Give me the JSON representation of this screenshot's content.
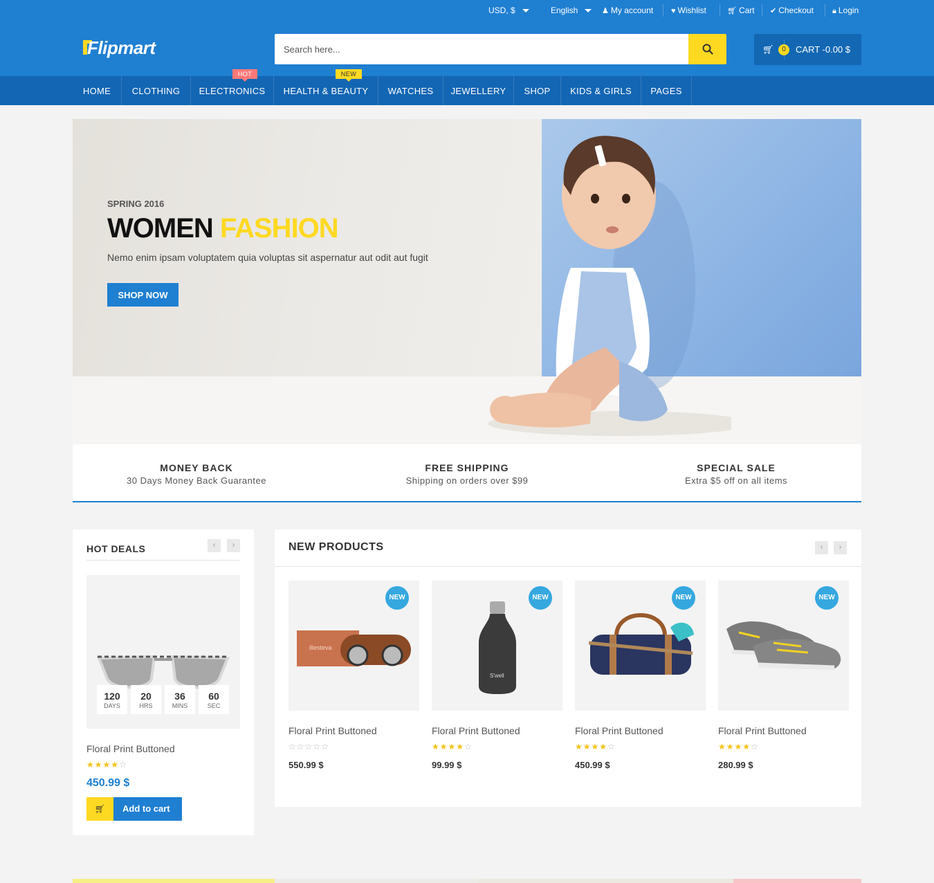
{
  "topbar": {
    "currency": "USD, $",
    "language": "English",
    "links": {
      "my_account": "My account",
      "wishlist": "Wishlist",
      "cart": "Cart",
      "checkout": "Checkout",
      "login": "Login"
    }
  },
  "header": {
    "logo_text": "Flipmart",
    "search_placeholder": "Search here...",
    "cart_count": "0",
    "cart_label": "CART -0.00 $"
  },
  "nav": {
    "items": [
      "HOME",
      "CLOTHING",
      "ELECTRONICS",
      "HEALTH & BEAUTY",
      "WATCHES",
      "JEWELLERY",
      "SHOP",
      "KIDS & GIRLS",
      "PAGES"
    ],
    "badges": {
      "hot": "HOT",
      "new": "NEW"
    }
  },
  "hero": {
    "season": "SPRING 2016",
    "headline_dark": "WOMEN",
    "headline_accent": "FASHION",
    "subtext": "Nemo enim ipsam voluptatem quia voluptas sit aspernatur aut odit aut fugit",
    "cta": "SHOP NOW"
  },
  "info_boxes": [
    {
      "title": "MONEY BACK",
      "subtitle": "30 Days Money Back Guarantee"
    },
    {
      "title": "FREE SHIPPING",
      "subtitle": "Shipping on orders over $99"
    },
    {
      "title": "SPECIAL SALE",
      "subtitle": "Extra $5 off on all items"
    }
  ],
  "hot_deals": {
    "title": "HOT DEALS",
    "countdown": [
      {
        "value": "120",
        "label": "DAYS"
      },
      {
        "value": "20",
        "label": "HRS"
      },
      {
        "value": "36",
        "label": "MINS"
      },
      {
        "value": "60",
        "label": "SEC"
      }
    ],
    "product": {
      "name": "Floral Print Buttoned",
      "rating": 4,
      "price": "450.99 $"
    },
    "add_to_cart": "Add to cart"
  },
  "new_products": {
    "title": "NEW PRODUCTS",
    "badge": "NEW",
    "items": [
      {
        "name": "Floral Print Buttoned",
        "rating": 0,
        "price": "550.99 $",
        "image": "sunglasses-with-case"
      },
      {
        "name": "Floral Print Buttoned",
        "rating": 4,
        "price": "99.99 $",
        "image": "black-water-bottle"
      },
      {
        "name": "Floral Print Buttoned",
        "rating": 4,
        "price": "450.99 $",
        "image": "navy-duffel-bag"
      },
      {
        "name": "Floral Print Buttoned",
        "rating": 4,
        "price": "280.99 $",
        "image": "grey-running-shoes"
      }
    ]
  },
  "bottle_brand": "S'well",
  "case_brand": "illesteva",
  "colors": {
    "primary": "#1f7fd1",
    "nav": "#1366b3",
    "accent": "#fdd922",
    "hot": "#ff7878",
    "new_badge": "#35a8e0"
  }
}
